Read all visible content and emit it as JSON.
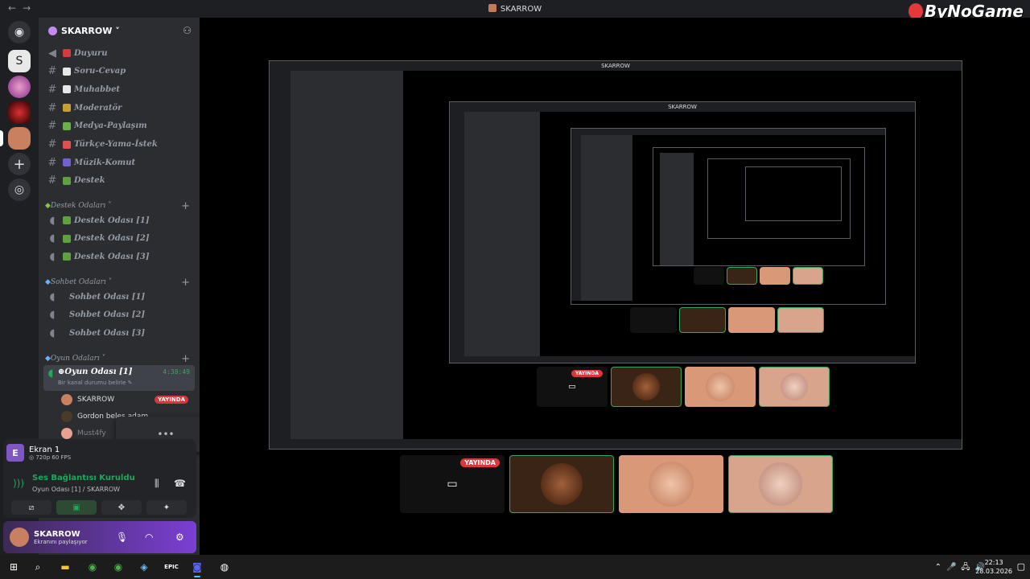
{
  "window": {
    "title": "SKARROW",
    "nav_back": "←",
    "nav_forward": "→"
  },
  "watermark": "ByNoGame",
  "server": {
    "name": "SKARROW ˅",
    "channels": [
      {
        "label": "Duyuru",
        "icon": "megaphone",
        "color": "#d23c3c"
      },
      {
        "label": "Soru-Cevap",
        "icon": "hash",
        "color": "#e8e8e8"
      },
      {
        "label": "Muhabbet",
        "icon": "hash",
        "color": "#e8e8e8"
      },
      {
        "label": "Moderatör",
        "icon": "hash",
        "color": "#c8a030"
      },
      {
        "label": "Medya-Paylaşım",
        "icon": "hash",
        "color": "#6ab04c"
      },
      {
        "label": "Türkçe-Yama-İstek",
        "icon": "hash",
        "color": "#e05050"
      },
      {
        "label": "Müzik-Komut",
        "icon": "hash",
        "color": "#7060d0"
      },
      {
        "label": "Destek",
        "icon": "hash",
        "color": "#60a040"
      }
    ],
    "categories": [
      {
        "name": "Destek Odaları ˅",
        "items": [
          "Destek Odası [1]",
          "Destek Odası [2]",
          "Destek Odası [3]"
        ]
      },
      {
        "name": "Sohbet Odaları ˅",
        "items": [
          "Sohbet Odası [1]",
          "Sohbet Odası [2]",
          "Sohbet Odası [3]"
        ]
      },
      {
        "name": "Oyun Odaları ˅",
        "items": []
      }
    ],
    "active_channel": {
      "label": "Oyun Odası [1]",
      "time": "4:38:49",
      "status": "Bir kanal durumu belirle ✎"
    },
    "members": [
      {
        "name": "SKARROW",
        "live": "YAYINDA"
      },
      {
        "name": "Gordon beleş adam",
        "live": ""
      },
      {
        "name": "Must4fy",
        "live": ""
      }
    ]
  },
  "tooltip": "•••",
  "screen_share": {
    "badge": "E",
    "title": "Ekran 1",
    "quality": "◎ 720p 60 FPS"
  },
  "voice": {
    "status": "Ses Bağlantısı Kuruldu",
    "channel": "Oyun Odası [1] / SKARROW"
  },
  "user": {
    "name": "SKARROW",
    "status": "Ekranını paylaşıyor"
  },
  "tiles": {
    "live_label": "YAYINDA"
  },
  "taskbar": {
    "time": "22:13",
    "date": "28.03.2026",
    "epic_label": "EPIC"
  }
}
